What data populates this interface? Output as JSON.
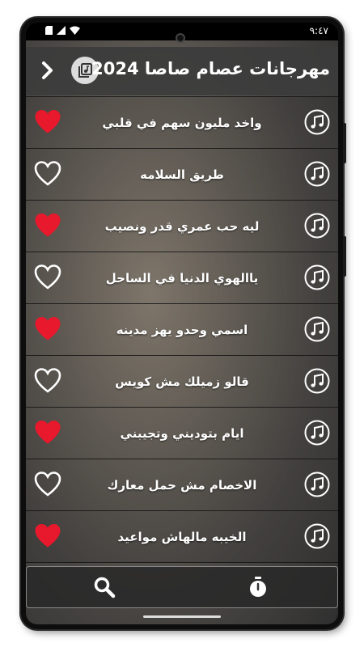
{
  "status": {
    "time": "٩:٤٧",
    "icons": [
      "sim-icon",
      "signal-icon",
      "wifi-icon"
    ]
  },
  "header": {
    "title": "مهرجانات عصام صاصا 2024",
    "back_icon": "chevron-right-icon",
    "media_icon": "music-library-icon"
  },
  "songs": [
    {
      "title": "واخد مليون سهم في قلبي",
      "favorite": true
    },
    {
      "title": "طريق السلامه",
      "favorite": false
    },
    {
      "title": "ليه حب عمري قدر ونصيب",
      "favorite": true
    },
    {
      "title": "ياالهوي الدنيا في الساحل",
      "favorite": false
    },
    {
      "title": "اسمي وحدو يهز مدينه",
      "favorite": true
    },
    {
      "title": "قالو زميلك مش كويس",
      "favorite": false
    },
    {
      "title": "ايام بتوديني وتجيبني",
      "favorite": true
    },
    {
      "title": "الاخصام مش حمل معارك",
      "favorite": false
    },
    {
      "title": "الخيبه مالهاش مواعيد",
      "favorite": true
    }
  ],
  "bottom": {
    "search_icon": "search-icon",
    "timer_icon": "stopwatch-icon"
  },
  "colors": {
    "heart_filled": "#e8192c",
    "heart_outline": "#ffffff",
    "header_bg": "#3c3c3c"
  }
}
